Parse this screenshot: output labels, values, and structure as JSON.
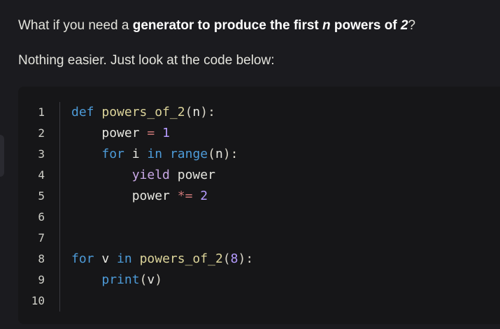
{
  "intro": {
    "p1_a": "What if you need a ",
    "p1_b": "generator to produce the first ",
    "p1_n": "n",
    "p1_c": " powers of ",
    "p1_two": "2",
    "p1_q": "?",
    "p2": "Nothing easier. Just look at the code below:"
  },
  "code_block": {
    "language": "python",
    "line_numbers": [
      "1",
      "2",
      "3",
      "4",
      "5",
      "6",
      "7",
      "8",
      "9",
      "10"
    ],
    "lines": [
      "def powers_of_2(n):",
      "    power = 1",
      "    for i in range(n):",
      "        yield power",
      "        power *= 2",
      "",
      "",
      "for v in powers_of_2(8):",
      "    print(v)",
      ""
    ]
  },
  "colors": {
    "background": "#1b1b1f",
    "code_background": "#161618",
    "keyword": "#4d9bd8",
    "function": "#dcd49a",
    "number": "#b59bff"
  }
}
